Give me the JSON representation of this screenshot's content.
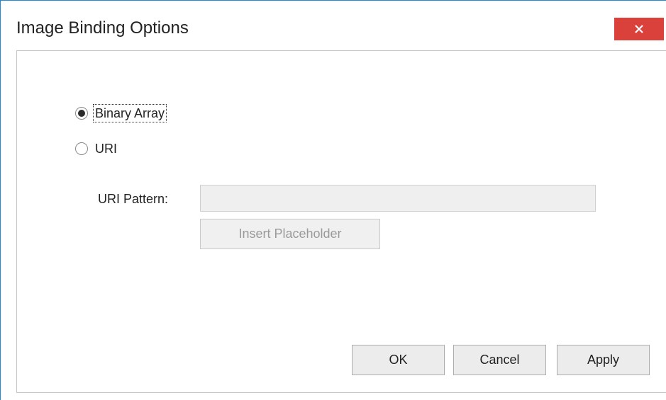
{
  "window": {
    "title": "Image Binding Options",
    "close_glyph": "✕",
    "close_icon": "close-icon"
  },
  "options": {
    "binary_array_label": "Binary Array",
    "uri_label": "URI",
    "selected": "Binary Array"
  },
  "uri_pattern": {
    "label": "URI Pattern:",
    "value": "",
    "insert_placeholder_label": "Insert Placeholder"
  },
  "footer": {
    "ok_label": "OK",
    "cancel_label": "Cancel",
    "apply_label": "Apply"
  },
  "colors": {
    "close_button": "#d9413a",
    "window_border": "#1f8ad8"
  }
}
